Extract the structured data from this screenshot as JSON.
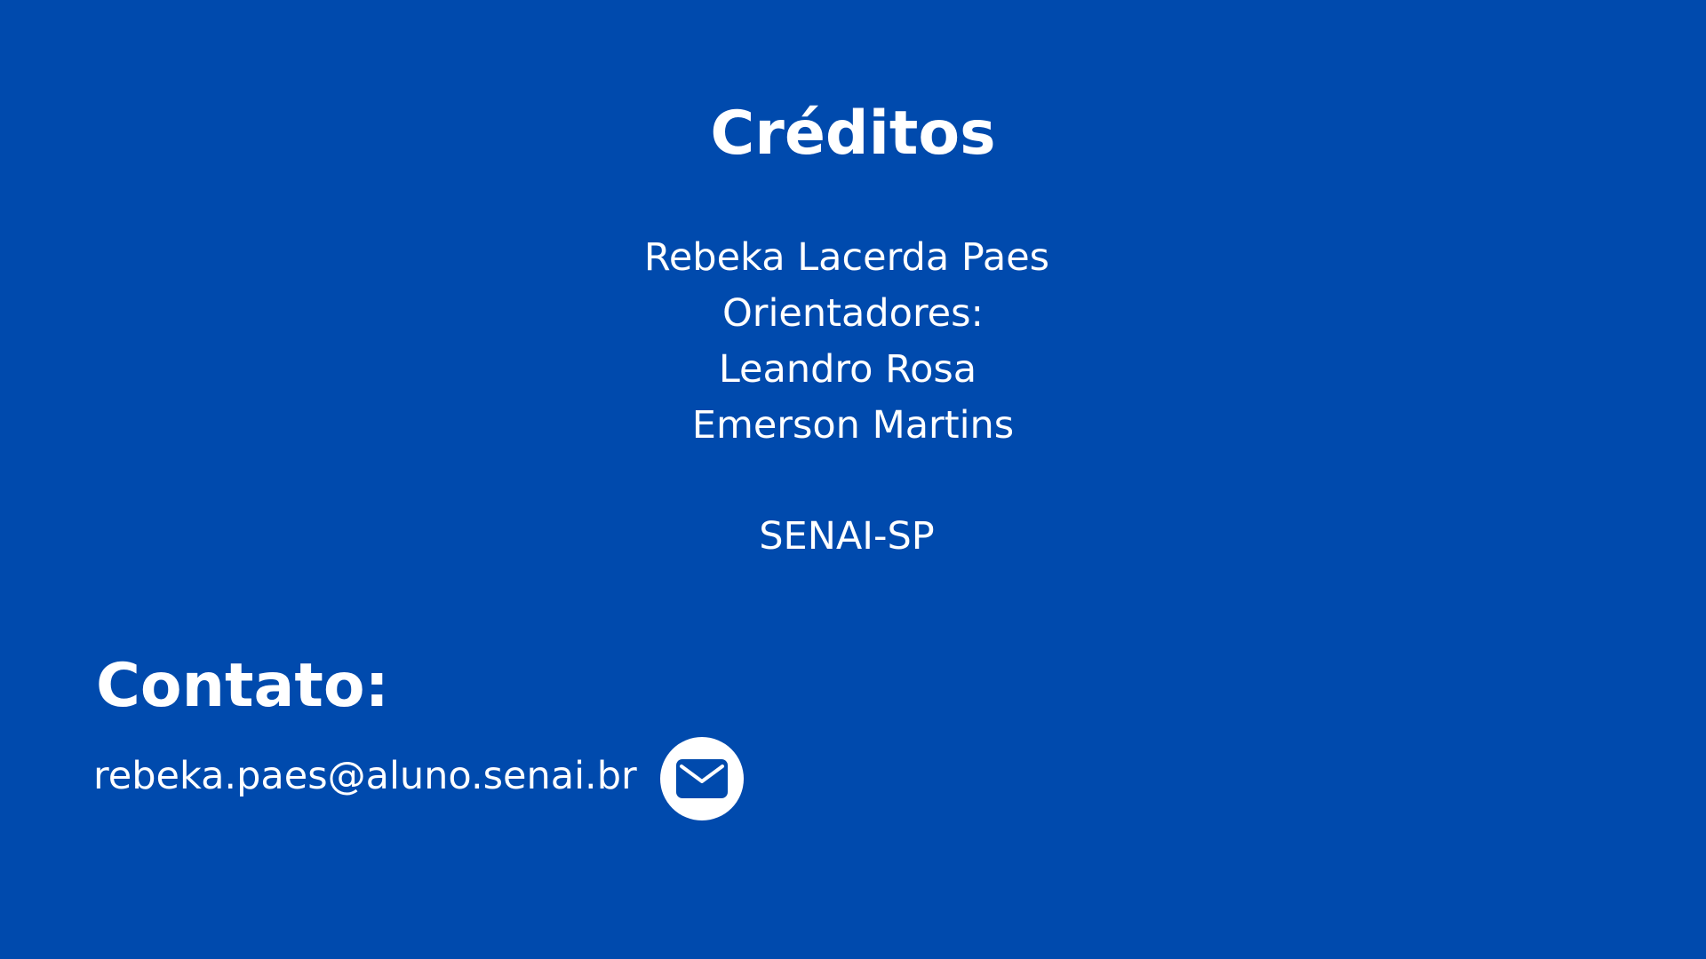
{
  "credits": {
    "title": "Créditos",
    "author": "Rebeka Lacerda Paes",
    "advisors_label": "Orientadores:",
    "advisors": [
      "Leandro Rosa",
      "Emerson Martins"
    ],
    "institution": "SENAI-SP"
  },
  "contact": {
    "title": "Contato:",
    "email": "rebeka.paes@aluno.senai.br",
    "icon": "envelope-icon"
  },
  "colors": {
    "background": "#004aad",
    "text": "#ffffff"
  }
}
